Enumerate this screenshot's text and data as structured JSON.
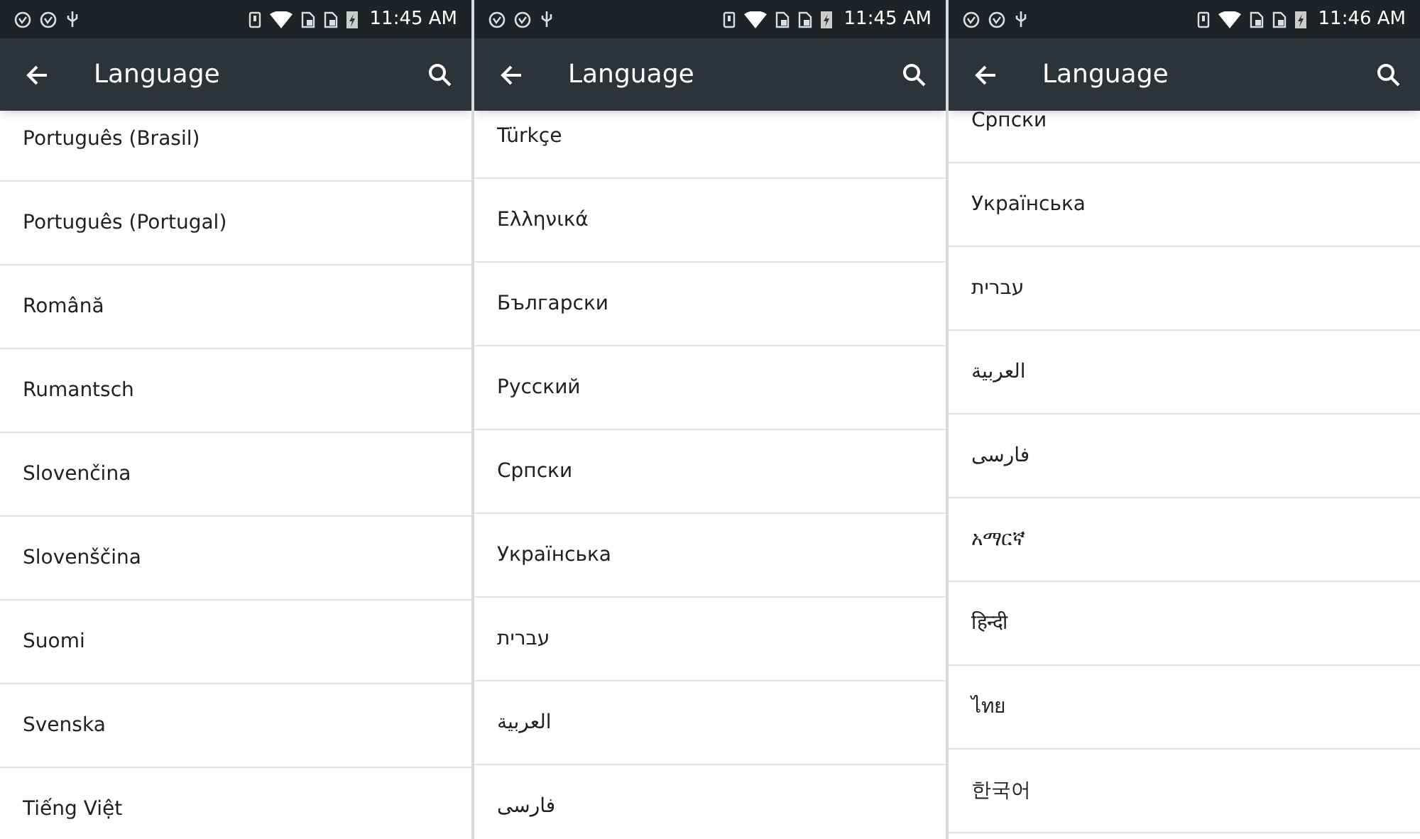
{
  "left_screen": {
    "status_bar": {
      "time": "11:45 AM"
    },
    "toolbar": {
      "title": "Language"
    },
    "languages": [
      "Português (Brasil)",
      "Português (Portugal)",
      "Română",
      "Rumantsch",
      "Slovenčina",
      "Slovenščina",
      "Suomi",
      "Svenska",
      "Tiếng Việt"
    ]
  },
  "middle_screen": {
    "status_bar": {
      "time": "11:45 AM"
    },
    "toolbar": {
      "title": "Language"
    },
    "languages": [
      "Türkçe",
      "Ελληνικά",
      "Български",
      "Русский",
      "Српски",
      "Українська",
      "עברית",
      "العربية",
      "فارسی"
    ]
  },
  "right_screen": {
    "status_bar": {
      "time": "11:46 AM"
    },
    "toolbar": {
      "title": "Language"
    },
    "languages": [
      "Српски",
      "Українська",
      "עברית",
      "العربية",
      "فارسی",
      "አማርኛ",
      "हिन्दी",
      "ไทย",
      "한국어"
    ]
  }
}
